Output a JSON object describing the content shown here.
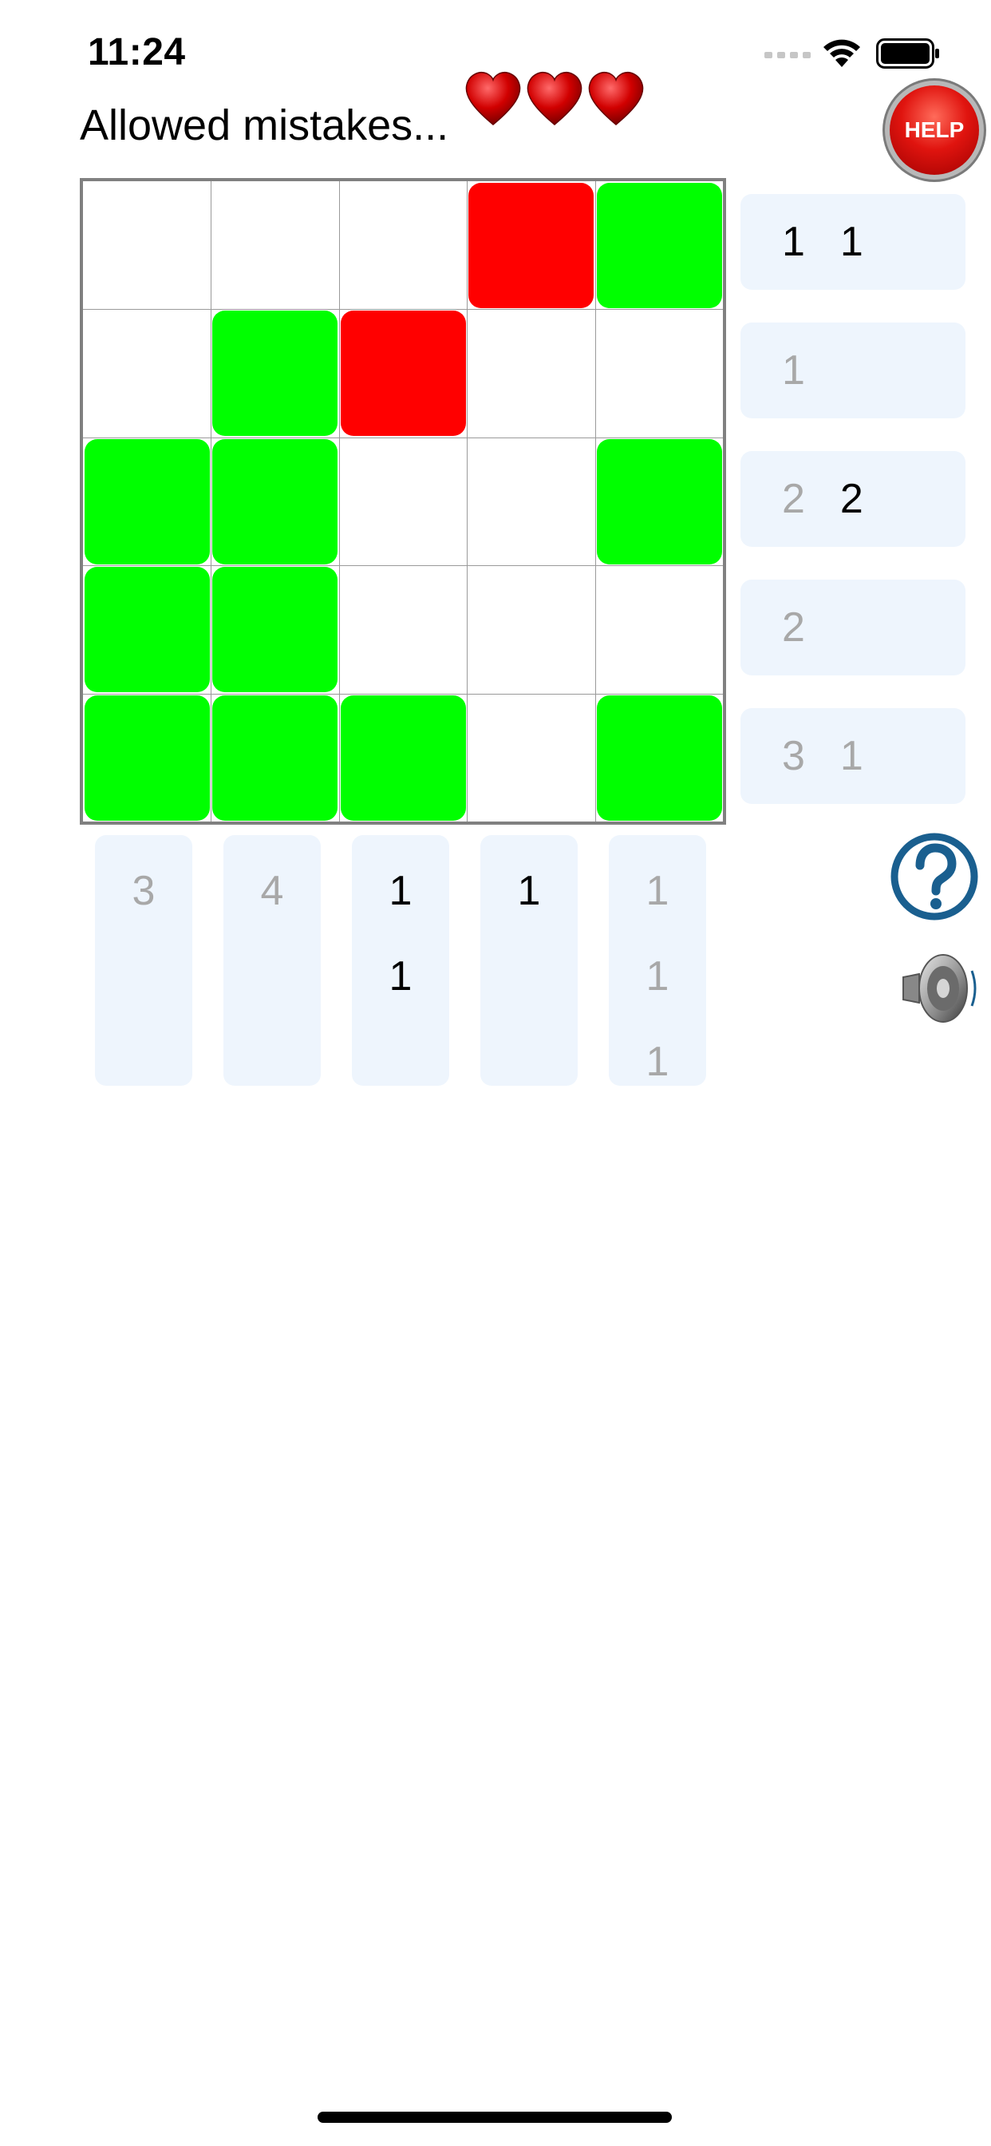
{
  "status_bar": {
    "time": "11:24"
  },
  "header": {
    "title": "Allowed mistakes...",
    "help_label": "HELP",
    "hearts_remaining": 3
  },
  "colors": {
    "filled": "#00ff00",
    "mistake": "#ff0000",
    "clue_done": "#a8a8a8",
    "clue_open": "#000000",
    "clue_bg": "#eef5fd"
  },
  "board": {
    "size": 5,
    "cells": [
      [
        "empty",
        "empty",
        "empty",
        "mistake",
        "filled"
      ],
      [
        "empty",
        "filled",
        "mistake",
        "empty",
        "empty"
      ],
      [
        "filled",
        "filled",
        "empty",
        "empty",
        "filled"
      ],
      [
        "filled",
        "filled",
        "empty",
        "empty",
        "empty"
      ],
      [
        "filled",
        "filled",
        "filled",
        "empty",
        "filled"
      ]
    ]
  },
  "row_clues": [
    [
      {
        "v": "1",
        "done": false
      },
      {
        "v": "1",
        "done": false
      }
    ],
    [
      {
        "v": "1",
        "done": true
      }
    ],
    [
      {
        "v": "2",
        "done": true
      },
      {
        "v": "2",
        "done": false
      }
    ],
    [
      {
        "v": "2",
        "done": true
      }
    ],
    [
      {
        "v": "3",
        "done": true
      },
      {
        "v": "1",
        "done": true
      }
    ]
  ],
  "col_clues": [
    [
      {
        "v": "3",
        "done": true
      }
    ],
    [
      {
        "v": "4",
        "done": true
      }
    ],
    [
      {
        "v": "1",
        "done": false
      },
      {
        "v": "1",
        "done": false
      }
    ],
    [
      {
        "v": "1",
        "done": false
      }
    ],
    [
      {
        "v": "1",
        "done": true
      },
      {
        "v": "1",
        "done": true
      },
      {
        "v": "1",
        "done": true
      }
    ]
  ],
  "icons": {
    "help": "help-button",
    "question": "question-mark-icon",
    "sound": "speaker-icon",
    "hearts": "heart-icon"
  }
}
